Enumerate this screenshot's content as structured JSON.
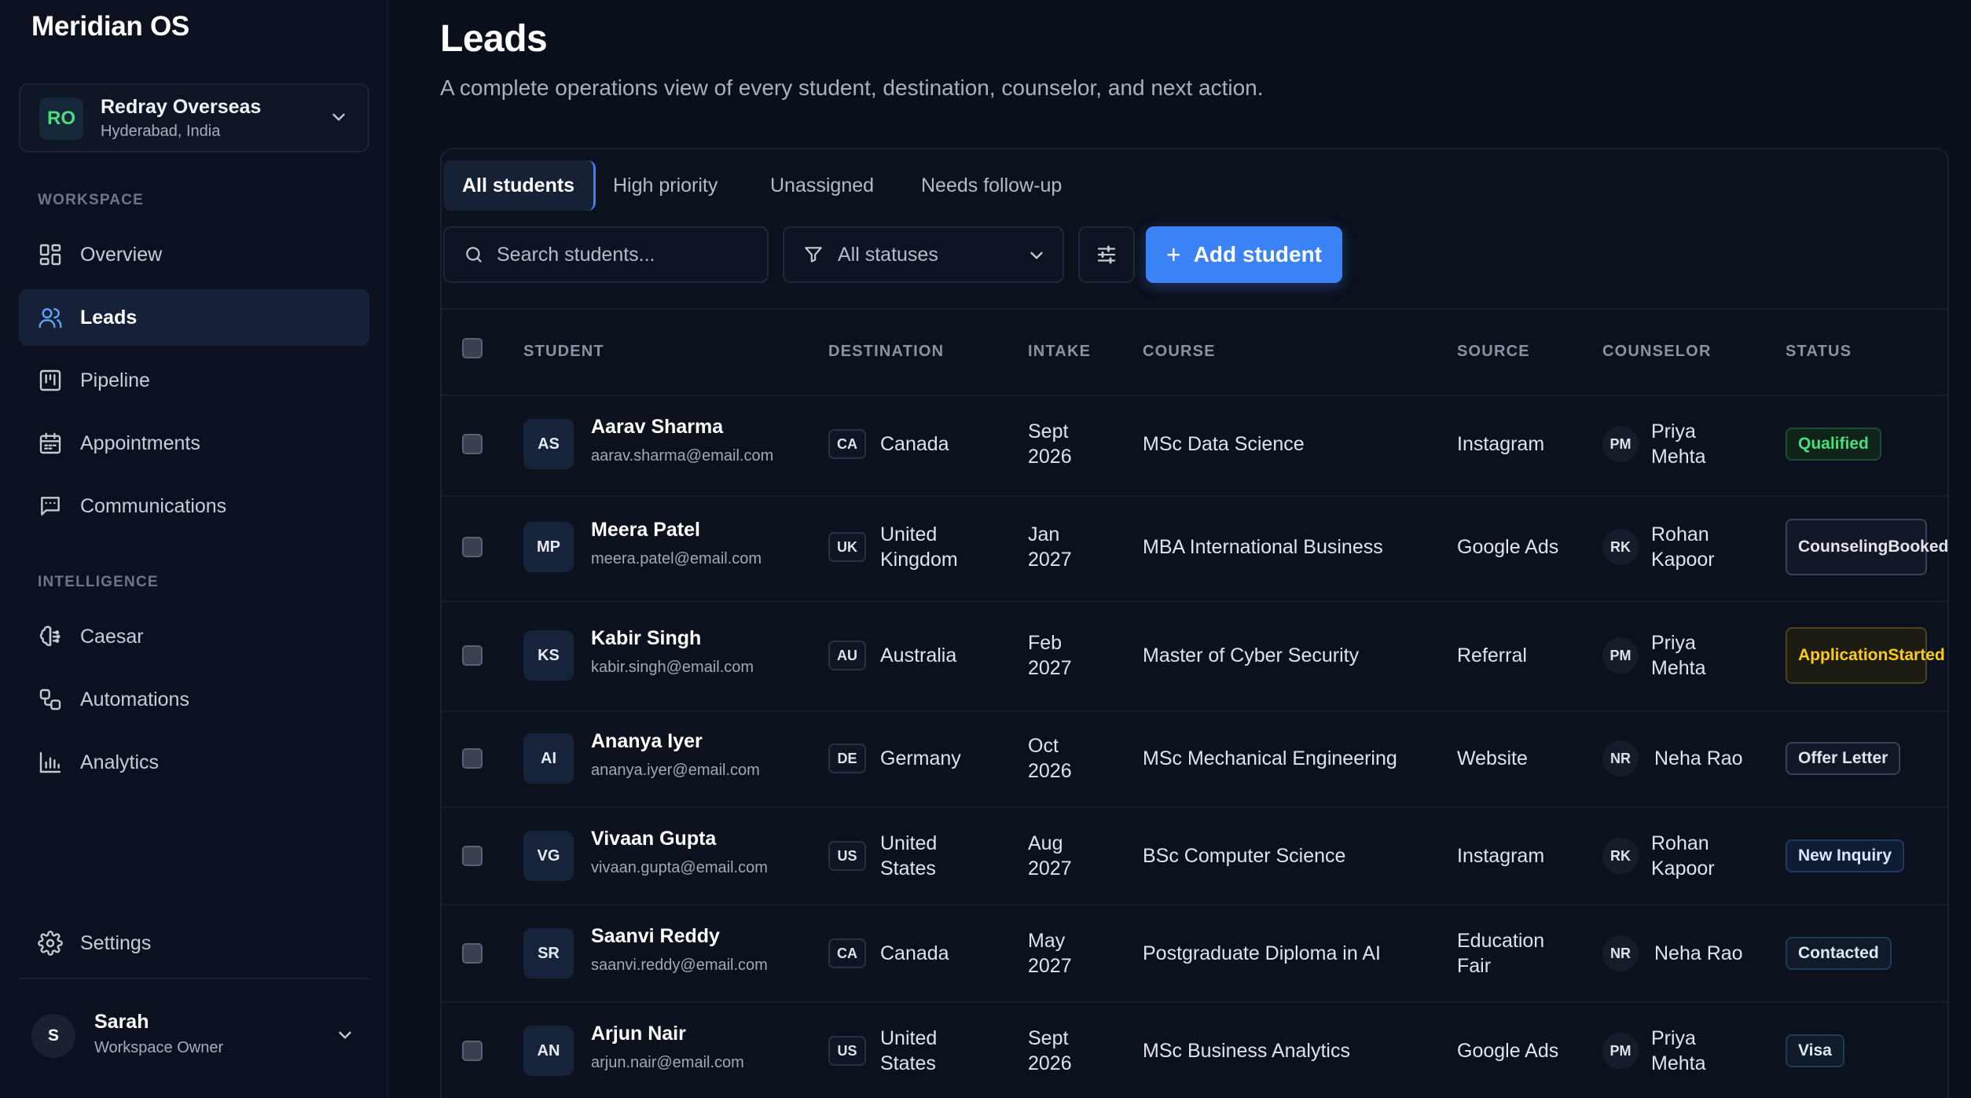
{
  "app": {
    "name": "Meridian OS"
  },
  "org": {
    "initials": "RO",
    "name": "Redray Overseas",
    "location": "Hyderabad, India"
  },
  "sidebar": {
    "workspace_label": "WORKSPACE",
    "intelligence_label": "INTELLIGENCE",
    "items": [
      {
        "label": "Overview",
        "icon": "grid-icon"
      },
      {
        "label": "Leads",
        "icon": "users-icon",
        "active": true
      },
      {
        "label": "Pipeline",
        "icon": "kanban-icon"
      },
      {
        "label": "Appointments",
        "icon": "calendar-icon"
      },
      {
        "label": "Communications",
        "icon": "message-icon"
      },
      {
        "label": "Caesar",
        "icon": "brain-icon"
      },
      {
        "label": "Automations",
        "icon": "workflow-icon"
      },
      {
        "label": "Analytics",
        "icon": "bar-chart-icon"
      },
      {
        "label": "Settings",
        "icon": "gear-icon"
      }
    ]
  },
  "user": {
    "initial": "S",
    "name": "Sarah",
    "role": "Workspace Owner"
  },
  "page": {
    "title": "Leads",
    "subtitle": "A complete operations view of every student, destination, counselor, and next action."
  },
  "tabs": [
    "All students",
    "High priority",
    "Unassigned",
    "Needs follow-up"
  ],
  "toolbar": {
    "search_placeholder": "Search students...",
    "status_filter": "All statuses",
    "add_label": "Add student"
  },
  "table": {
    "columns": [
      "STUDENT",
      "DESTINATION",
      "INTAKE",
      "COURSE",
      "SOURCE",
      "COUNSELOR",
      "STATUS"
    ],
    "rows": [
      {
        "initials": "AS",
        "name": "Aarav Sharma",
        "email": "aarav.sharma@email.com",
        "dest_code": "CA",
        "dest_l1": "Canada",
        "dest_l2": "",
        "intake_l1": "Sept",
        "intake_l2": "2026",
        "course": "MSc Data Science",
        "source_l1": "Instagram",
        "source_l2": "",
        "c_initials": "PM",
        "c_l1": "Priya",
        "c_l2": "Mehta",
        "status_l1": "Qualified",
        "status_l2": "",
        "tone": "green"
      },
      {
        "initials": "MP",
        "name": "Meera Patel",
        "email": "meera.patel@email.com",
        "dest_code": "UK",
        "dest_l1": "United",
        "dest_l2": "Kingdom",
        "intake_l1": "Jan",
        "intake_l2": "2027",
        "course": "MBA International Business",
        "source_l1": "Google Ads",
        "source_l2": "",
        "c_initials": "RK",
        "c_l1": "Rohan",
        "c_l2": "Kapoor",
        "status_l1": "Counseling",
        "status_l2": "Booked",
        "tone": "gray"
      },
      {
        "initials": "KS",
        "name": "Kabir Singh",
        "email": "kabir.singh@email.com",
        "dest_code": "AU",
        "dest_l1": "Australia",
        "dest_l2": "",
        "intake_l1": "Feb",
        "intake_l2": "2027",
        "course": "Master of Cyber Security",
        "source_l1": "Referral",
        "source_l2": "",
        "c_initials": "PM",
        "c_l1": "Priya",
        "c_l2": "Mehta",
        "status_l1": "Application",
        "status_l2": "Started",
        "tone": "yellow"
      },
      {
        "initials": "AI",
        "name": "Ananya Iyer",
        "email": "ananya.iyer@email.com",
        "dest_code": "DE",
        "dest_l1": "Germany",
        "dest_l2": "",
        "intake_l1": "Oct",
        "intake_l2": "2026",
        "course": "MSc Mechanical Engineering",
        "source_l1": "Website",
        "source_l2": "",
        "c_initials": "NR",
        "c_l1": "Neha Rao",
        "c_l2": "",
        "status_l1": "Offer Letter",
        "status_l2": "",
        "tone": "gray"
      },
      {
        "initials": "VG",
        "name": "Vivaan Gupta",
        "email": "vivaan.gupta@email.com",
        "dest_code": "US",
        "dest_l1": "United",
        "dest_l2": "States",
        "intake_l1": "Aug",
        "intake_l2": "2027",
        "course": "BSc Computer Science",
        "source_l1": "Instagram",
        "source_l2": "",
        "c_initials": "RK",
        "c_l1": "Rohan",
        "c_l2": "Kapoor",
        "status_l1": "New Inquiry",
        "status_l2": "",
        "tone": "blue"
      },
      {
        "initials": "SR",
        "name": "Saanvi Reddy",
        "email": "saanvi.reddy@email.com",
        "dest_code": "CA",
        "dest_l1": "Canada",
        "dest_l2": "",
        "intake_l1": "May",
        "intake_l2": "2027",
        "course": "Postgraduate Diploma in AI",
        "source_l1": "Education",
        "source_l2": "Fair",
        "c_initials": "NR",
        "c_l1": "Neha Rao",
        "c_l2": "",
        "status_l1": "Contacted",
        "status_l2": "",
        "tone": "teal"
      },
      {
        "initials": "AN",
        "name": "Arjun Nair",
        "email": "arjun.nair@email.com",
        "dest_code": "US",
        "dest_l1": "United",
        "dest_l2": "States",
        "intake_l1": "Sept",
        "intake_l2": "2026",
        "course": "MSc Business Analytics",
        "source_l1": "Google Ads",
        "source_l2": "",
        "c_initials": "PM",
        "c_l1": "Priya",
        "c_l2": "Mehta",
        "status_l1": "Visa",
        "status_l2": "",
        "tone": "teal"
      }
    ]
  }
}
